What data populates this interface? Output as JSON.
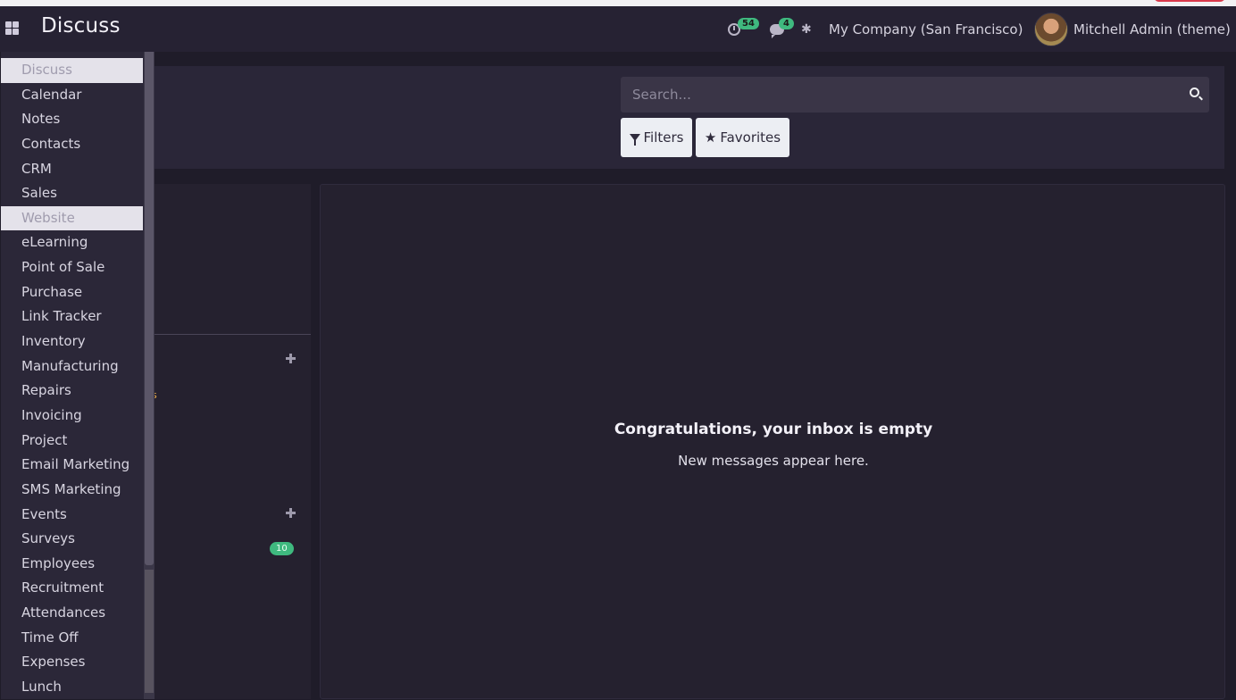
{
  "navbar": {
    "brand": "Discuss",
    "activity_count": "54",
    "messages_count": "4",
    "company": "My Company (San Francisco)",
    "user": "Mitchell Admin (theme)"
  },
  "app_menu": {
    "items": [
      "Discuss",
      "Calendar",
      "Notes",
      "Contacts",
      "CRM",
      "Sales",
      "Website",
      "eLearning",
      "Point of Sale",
      "Purchase",
      "Link Tracker",
      "Inventory",
      "Manufacturing",
      "Repairs",
      "Invoicing",
      "Project",
      "Email Marketing",
      "SMS Marketing",
      "Events",
      "Surveys",
      "Employees",
      "Recruitment",
      "Attendances",
      "Time Off",
      "Expenses",
      "Lunch"
    ]
  },
  "search": {
    "placeholder": "Search...",
    "filters_label": "Filters",
    "favorites_label": "Favorites"
  },
  "sidebar": {
    "channel_count": "10",
    "stray": "s"
  },
  "thread": {
    "empty_title": "Congratulations, your inbox is empty",
    "empty_subtitle": "New messages appear here."
  },
  "colors": {
    "accent_badge": "#3fb97f",
    "navbar": "#262233",
    "background": "#1f1c29"
  }
}
